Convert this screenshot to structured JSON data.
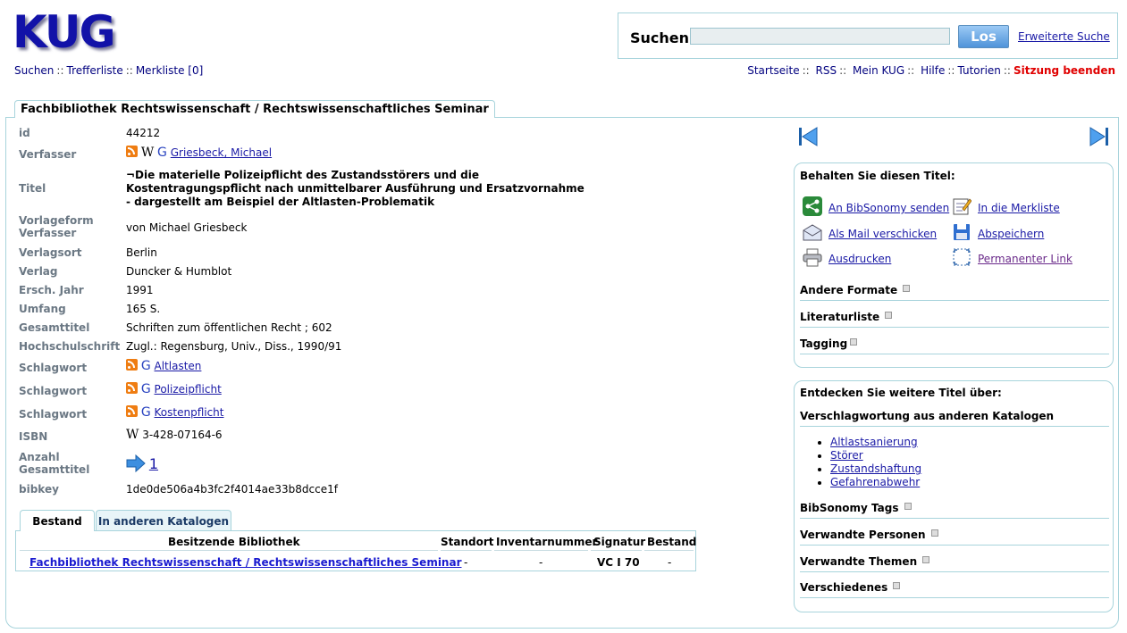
{
  "logo": "KUG",
  "search": {
    "label": "Suchen",
    "value": "",
    "button": "Los",
    "advanced": "Erweiterte Suche"
  },
  "leftnav": {
    "search": "Suchen",
    "hits": "Trefferliste",
    "bookmarks": "Merkliste [0]"
  },
  "rightnav": {
    "home": "Startseite",
    "rss": "RSS",
    "mykug": "Mein KUG",
    "help": "Hilfe",
    "tutorials": "Tutorien",
    "logout": "Sitzung beenden"
  },
  "main_tab": "Fachbibliothek Rechtswissenschaft / Rechtswissenschaftliches Seminar",
  "record": {
    "id_label": "id",
    "id": "44212",
    "author_label": "Verfasser",
    "author": "Griesbeck, Michael",
    "title_label": "Titel",
    "title_line1": "¬Die materielle Polizeipflicht des Zustandsstörers und die",
    "title_line2": "Kostentragungspflicht nach unmittelbarer Ausführung und Ersatzvornahme",
    "title_line3": "- dargestellt am Beispiel der Altlasten-Problematik",
    "form_label_1": "Vorlageform",
    "form_label_2": "Verfasser",
    "form_author": "von Michael Griesbeck",
    "place_label": "Verlagsort",
    "place": "Berlin",
    "publisher_label": "Verlag",
    "publisher": "Duncker & Humblot",
    "year_label": "Ersch. Jahr",
    "year": "1991",
    "extent_label": "Umfang",
    "extent": "165 S.",
    "series_label": "Gesamttitel",
    "series": "Schriften zum öffentlichen Recht ; 602",
    "thesis_label": "Hochschulschrift",
    "thesis": "Zugl.: Regensburg, Univ., Diss., 1990/91",
    "subject_label": "Schlagwort",
    "subjects": [
      "Altlasten",
      "Polizeipflicht",
      "Kostenpflicht"
    ],
    "isbn_label": "ISBN",
    "isbn": "3-428-07164-6",
    "count_label_1": "Anzahl",
    "count_label_2": "Gesamttitel",
    "count": "1",
    "bibkey_label": "bibkey",
    "bibkey": "1de0de506a4b3fc2f4014ae33b8dcce1f"
  },
  "wiki_glyph": "W",
  "g_glyph": "G",
  "holdings_tabs": [
    "Bestand",
    "In anderen Katalogen"
  ],
  "holdings": {
    "headers": [
      "Besitzende Bibliothek",
      "Standort",
      "Inventarnummer",
      "Signatur",
      "Bestand"
    ],
    "row": [
      "Fachbibliothek Rechtswissenschaft / Rechtswissenschaftliches Seminar",
      "-",
      "-",
      "VC I 70",
      "-"
    ]
  },
  "keep_box": {
    "title": "Behalten Sie diesen Titel:",
    "actions": [
      "An BibSonomy senden",
      "In die Merkliste",
      "Als Mail verschicken",
      "Abspeichern",
      "Ausdrucken",
      "Permanenter Link"
    ],
    "sections": [
      "Andere Formate",
      "Literaturliste",
      "Tagging"
    ]
  },
  "discover_box": {
    "title": "Entdecken Sie weitere Titel über:",
    "subtitle": "Verschlagwortung aus anderen Katalogen",
    "keywords": [
      "Altlastsanierung",
      "Störer",
      "Zustandshaftung",
      "Gefahrenabwehr"
    ],
    "sections": [
      "BibSonomy Tags",
      "Verwandte Personen",
      "Verwandte Themen",
      "Verschiedenes"
    ]
  },
  "colors": {
    "border": "#a8d4dc",
    "link": "#1a1aa6",
    "nav": "#00007f",
    "logout": "#e00000",
    "label": "#6b7884"
  }
}
